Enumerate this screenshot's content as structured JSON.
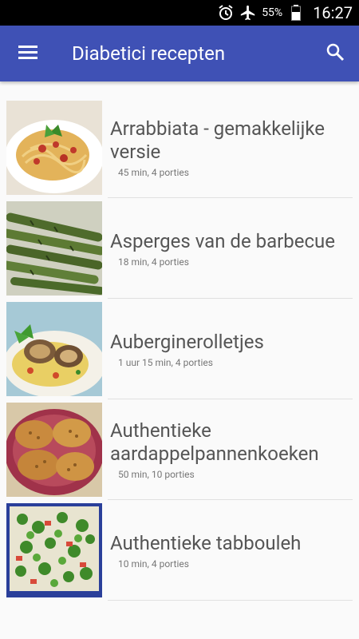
{
  "statusbar": {
    "battery": "55%",
    "time": "16:27"
  },
  "toolbar": {
    "title": "Diabetici recepten"
  },
  "recipes": [
    {
      "name": "Arrabbiata - gemakkelijke versie",
      "meta": "45 min, 4 porties"
    },
    {
      "name": "Asperges van de barbecue",
      "meta": "18 min, 4 porties"
    },
    {
      "name": "Auberginerolletjes",
      "meta": "1 uur 15 min, 4 porties"
    },
    {
      "name": "Authentieke aardappelpannenkoeken",
      "meta": "50 min, 10 porties"
    },
    {
      "name": "Authentieke tabbouleh",
      "meta": "10 min, 4 porties"
    }
  ],
  "colors": {
    "toolbar": "#3f51b5",
    "statusbar": "#000000"
  }
}
